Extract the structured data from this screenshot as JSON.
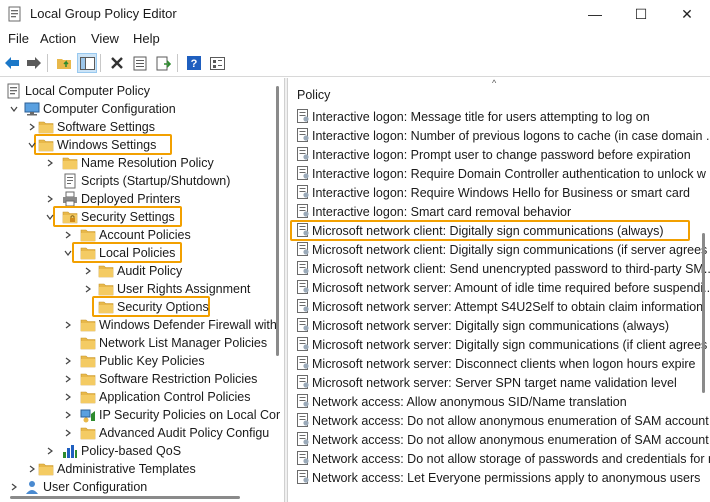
{
  "window": {
    "title": "Local Group Policy Editor",
    "minimize_glyph": "—",
    "maximize_glyph": "☐",
    "close_glyph": "✕"
  },
  "menu": [
    "File",
    "Action",
    "View",
    "Help"
  ],
  "toolbar": {
    "icons": [
      "back-icon",
      "forward-icon",
      "up-folder-icon",
      "show-hide-tree-icon",
      "delete-icon",
      "properties-icon",
      "export-list-icon",
      "help-icon",
      "view-icon"
    ]
  },
  "tree": [
    {
      "label": "Local Computer Policy",
      "icon": "computer-policy-icon",
      "expanded": true
    },
    {
      "label": "Computer Configuration",
      "icon": "computer-icon",
      "expanded": true
    },
    {
      "label": "Software Settings",
      "icon": "folder-icon",
      "expanded": false
    },
    {
      "label": "Windows Settings",
      "icon": "folder-icon",
      "expanded": true,
      "highlighted": true
    },
    {
      "label": "Name Resolution Policy",
      "icon": "folder-icon",
      "expanded": false
    },
    {
      "label": "Scripts (Startup/Shutdown)",
      "icon": "script-icon",
      "expanded": null
    },
    {
      "label": "Deployed Printers",
      "icon": "printer-icon",
      "expanded": false
    },
    {
      "label": "Security Settings",
      "icon": "security-folder-icon",
      "expanded": true,
      "highlighted": true
    },
    {
      "label": "Account Policies",
      "icon": "folder-icon",
      "expanded": false
    },
    {
      "label": "Local Policies",
      "icon": "folder-icon",
      "expanded": true,
      "highlighted": true
    },
    {
      "label": "Audit Policy",
      "icon": "folder-icon",
      "expanded": false
    },
    {
      "label": "User Rights Assignment",
      "icon": "folder-icon",
      "expanded": false
    },
    {
      "label": "Security Options",
      "icon": "folder-icon",
      "expanded": null,
      "highlighted": true
    },
    {
      "label": "Windows Defender Firewall with",
      "icon": "folder-icon",
      "expanded": false
    },
    {
      "label": "Network List Manager Policies",
      "icon": "folder-icon",
      "expanded": null
    },
    {
      "label": "Public Key Policies",
      "icon": "folder-icon",
      "expanded": false
    },
    {
      "label": "Software Restriction Policies",
      "icon": "folder-icon",
      "expanded": false
    },
    {
      "label": "Application Control Policies",
      "icon": "folder-icon",
      "expanded": false
    },
    {
      "label": "IP Security Policies on Local Cor",
      "icon": "ipsec-icon",
      "expanded": false
    },
    {
      "label": "Advanced Audit Policy Configu",
      "icon": "folder-icon",
      "expanded": false
    },
    {
      "label": "Policy-based QoS",
      "icon": "qos-chart-icon",
      "expanded": false
    },
    {
      "label": "Administrative Templates",
      "icon": "folder-icon",
      "expanded": false
    },
    {
      "label": "User Configuration",
      "icon": "user-icon",
      "expanded": false
    }
  ],
  "list": {
    "column": "Policy",
    "sort_glyph": "^",
    "rows": [
      "Interactive logon: Message title for users attempting to log on",
      "Interactive logon: Number of previous logons to cache (in case domain ...",
      "Interactive logon: Prompt user to change password before expiration",
      "Interactive logon: Require Domain Controller authentication to unlock w",
      "Interactive logon: Require Windows Hello for Business or smart card",
      "Interactive logon: Smart card removal behavior",
      "Microsoft network client: Digitally sign communications (always)",
      "Microsoft network client: Digitally sign communications (if server agrees",
      "Microsoft network client: Send unencrypted password to third-party SM...",
      "Microsoft network server: Amount of idle time required before suspendi...",
      "Microsoft network server: Attempt S4U2Self to obtain claim information",
      "Microsoft network server: Digitally sign communications (always)",
      "Microsoft network server: Digitally sign communications (if client agrees",
      "Microsoft network server: Disconnect clients when logon hours expire",
      "Microsoft network server: Server SPN target name validation level",
      "Network access: Allow anonymous SID/Name translation",
      "Network access: Do not allow anonymous enumeration of SAM account",
      "Network access: Do not allow anonymous enumeration of SAM account",
      "Network access: Do not allow storage of passwords and credentials for n",
      "Network access: Let Everyone permissions apply to anonymous users"
    ],
    "selected_index": 6
  },
  "colors": {
    "highlight_border": "#f2a000",
    "folder": "#e8b84a",
    "selection": "#cce4f7"
  }
}
